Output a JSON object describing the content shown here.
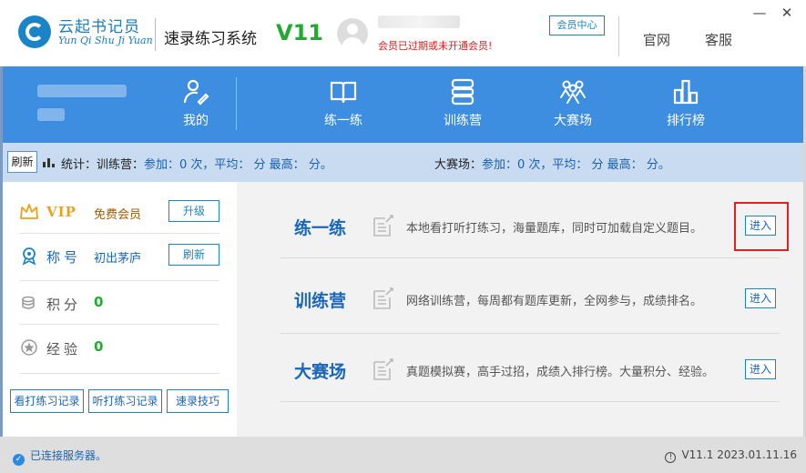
{
  "header": {
    "brand_cn": "云起书记员",
    "brand_en": "Yun Qi Shu Ji Yuan",
    "app_title": "速录练习系统",
    "version": "V11",
    "member_warning": "会员已过期或未开通会员!",
    "member_center": "会员中心",
    "links": [
      "官网",
      "客服"
    ],
    "minimize": "—",
    "close": "✕"
  },
  "nav": {
    "my": "我的",
    "items": [
      "练一练",
      "训练营",
      "大赛场",
      "排行榜"
    ]
  },
  "stats": {
    "refresh": "刷新",
    "camp_label": "统计：训练营：",
    "camp_text": "参加：0 次，平均： 分 最高： 分。",
    "arena_label": "大赛场：",
    "arena_text": "参加：0 次，平均： 分 最高： 分。"
  },
  "profile": {
    "vip_label": "VIP",
    "vip_value": "免费会员",
    "upgrade": "升级",
    "title_label": "称号",
    "title_value": "初出茅庐",
    "refresh": "刷新",
    "points_label": "积分",
    "points_value": "0",
    "exp_label": "经验",
    "exp_value": "0",
    "bottom_buttons": [
      "看打练习记录",
      "听打练习记录",
      "速录技巧"
    ]
  },
  "modes": [
    {
      "title": "练一练",
      "desc": "本地看打听打练习，海量题库，同时可加载自定义题目。",
      "enter": "进入"
    },
    {
      "title": "训练营",
      "desc": "网络训练营，每周都有题库更新，全网参与，成绩排名。",
      "enter": "进入"
    },
    {
      "title": "大赛场",
      "desc": "真题模拟赛，高手过招，成绩入排行榜。大量积分、经验。",
      "enter": "进入"
    }
  ],
  "status": {
    "connected": "已连接服务器。",
    "version_info": "V11.1 2023.01.11.16"
  },
  "colors": {
    "accent": "#3d8de0",
    "brand": "#1a84c6",
    "version_green": "#22aa33",
    "warning_red": "#e01b1b",
    "highlight": "#e02020"
  }
}
